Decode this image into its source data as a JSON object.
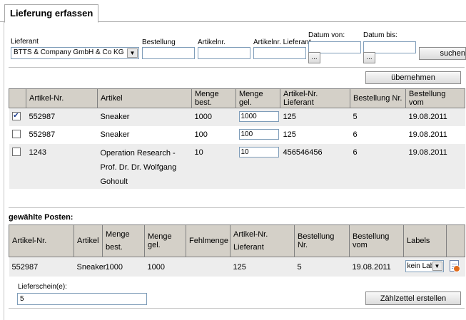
{
  "tab": {
    "title": "Lieferung erfassen"
  },
  "filters": {
    "supplier_label": "Lieferant",
    "supplier_value": "BTTS & Company GmbH & Co KG",
    "order_label": "Bestellung",
    "order_value": "",
    "article_label": "Artikelnr.",
    "article_value": "",
    "supplier_article_label": "Artikelnr. Lieferant",
    "supplier_article_value": "",
    "date_from_label": "Datum von:",
    "date_from_value": "",
    "date_to_label": "Datum bis:",
    "date_to_value": "",
    "picker_label": "...",
    "search_label": "suchen"
  },
  "apply_label": "übernehmen",
  "orders_table": {
    "headers": [
      "Artikel-Nr.",
      "Artikel",
      "Menge best.",
      "Menge gel.",
      "Artikel-Nr. Lieferant",
      "Bestellung Nr.",
      "Bestellung vom"
    ],
    "rows": [
      {
        "checked": true,
        "article_no": "552987",
        "article": "Sneaker",
        "qty_ordered": "1000",
        "qty_delivered": "1000",
        "supplier_no": "125",
        "order_no": "5",
        "order_date": "19.08.2011"
      },
      {
        "checked": false,
        "article_no": "552987",
        "article": "Sneaker",
        "qty_ordered": "100",
        "qty_delivered": "100",
        "supplier_no": "125",
        "order_no": "6",
        "order_date": "19.08.2011"
      },
      {
        "checked": false,
        "article_no": "1243",
        "article": "Operation Research - Prof. Dr. Dr. Wolfgang Gohoult",
        "qty_ordered": "10",
        "qty_delivered": "10",
        "supplier_no": "456546456",
        "order_no": "6",
        "order_date": "19.08.2011"
      }
    ]
  },
  "selected": {
    "title": "gewählte Posten:",
    "headers": [
      "Artikel-Nr.",
      "Artikel",
      "Menge best.",
      "Menge gel.",
      "Fehlmenge",
      "Artikel-Nr. Lieferant",
      "Bestellung Nr.",
      "Bestellung vom",
      "Labels"
    ],
    "rows": [
      {
        "article_no": "552987",
        "article": "Sneaker",
        "qty_ordered": "1000",
        "qty_delivered": "1000",
        "missing": "",
        "supplier_no": "125",
        "order_no": "5",
        "order_date": "19.08.2011",
        "label": "kein Label"
      }
    ]
  },
  "delivery_note": {
    "label": "Lieferschein(e):",
    "value": "5"
  },
  "count_label": "Zählzettel erstellen",
  "colors": {
    "header_bg": "#d4d0c8",
    "row_alt": "#ededed",
    "border": "#7f9db9"
  },
  "icons": {
    "checkbox": "check-icon",
    "dropdown": "chevron-down-icon",
    "remove": "document-remove-icon"
  }
}
